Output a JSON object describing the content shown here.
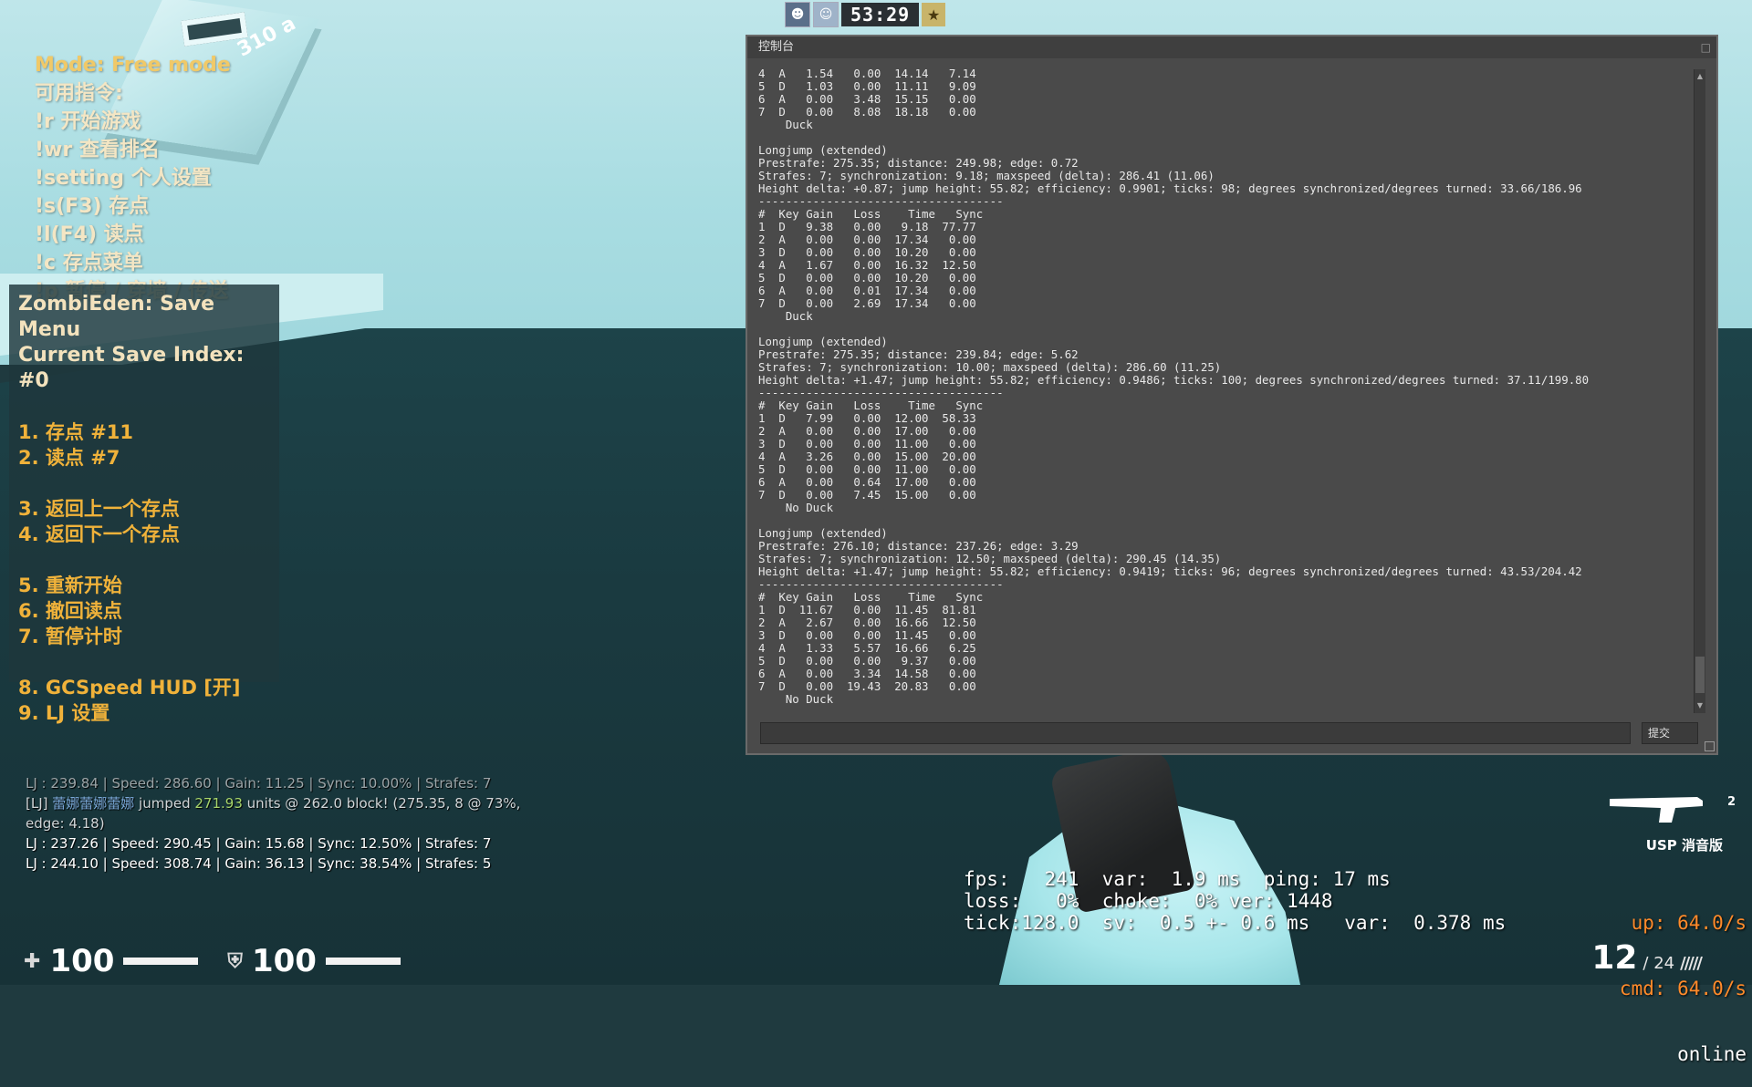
{
  "scoreboard": {
    "timer": "53:29"
  },
  "cube_label": "310 a",
  "free_mode": {
    "mode": "Mode: Free mode",
    "lines": [
      "可用指令:",
      "!r 开始游戏",
      "!wr 查看排名",
      "!setting 个人设置",
      "!s(F3) 存点",
      "!l(F4) 读点",
      "!c 存点菜单",
      "!p 暂停 / 穿墙 / 传送"
    ]
  },
  "save_menu": {
    "title": "ZombiEden: Save Menu",
    "index": "Current Save Index: #0",
    "items": [
      "1. 存点 #11",
      "2. 读点 #7",
      "3. 返回上一个存点",
      "4. 返回下一个存点",
      "5. 重新开始",
      "6. 撤回读点",
      "7. 暂停计时",
      "8. GCSpeed HUD [开]",
      "9. LJ 设置"
    ]
  },
  "chatlog": {
    "line1": "LJ : 239.84 | Speed: 286.60 | Gain: 11.25 | Sync: 10.00% | Strafes: 7",
    "line2_tag": "[LJ] ",
    "line2_name": "蕾娜蕾娜蕾娜",
    "line2_mid": " jumped ",
    "line2_dist": "271.93",
    "line2_rest": " units @ 262.0 block! (275.35, 8 @ 73%,",
    "line3": "edge: 4.18)",
    "line4": "LJ : 237.26 | Speed: 290.45 | Gain: 15.68 | Sync: 12.50% | Strafes: 7",
    "line5": "LJ : 244.10 | Speed: 308.74 | Gain: 36.13 | Sync: 38.54% | Strafes: 5"
  },
  "console": {
    "title": "控制台",
    "submit": "提交",
    "output": "4  A   1.54   0.00  14.14   7.14\n5  D   1.03   0.00  11.11   9.09\n6  A   0.00   3.48  15.15   0.00\n7  D   0.00   8.08  18.18   0.00\n    Duck\n\nLongjump (extended)\nPrestrafe: 275.35; distance: 249.98; edge: 0.72\nStrafes: 7; synchronization: 9.18; maxspeed (delta): 286.41 (11.06)\nHeight delta: +0.87; jump height: 55.82; efficiency: 0.9901; ticks: 98; degrees synchronized/degrees turned: 33.66/186.96\n------------------------------------\n#  Key Gain   Loss    Time   Sync\n1  D   9.38   0.00   9.18  77.77\n2  A   0.00   0.00  17.34   0.00\n3  D   0.00   0.00  10.20   0.00\n4  A   1.67   0.00  16.32  12.50\n5  D   0.00   0.00  10.20   0.00\n6  A   0.00   0.01  17.34   0.00\n7  D   0.00   2.69  17.34   0.00\n    Duck\n\nLongjump (extended)\nPrestrafe: 275.35; distance: 239.84; edge: 5.62\nStrafes: 7; synchronization: 10.00; maxspeed (delta): 286.60 (11.25)\nHeight delta: +1.47; jump height: 55.82; efficiency: 0.9486; ticks: 100; degrees synchronized/degrees turned: 37.11/199.80\n------------------------------------\n#  Key Gain   Loss    Time   Sync\n1  D   7.99   0.00  12.00  58.33\n2  A   0.00   0.00  17.00   0.00\n3  D   0.00   0.00  11.00   0.00\n4  A   3.26   0.00  15.00  20.00\n5  D   0.00   0.00  11.00   0.00\n6  A   0.00   0.64  17.00   0.00\n7  D   0.00   7.45  15.00   0.00\n    No Duck\n\nLongjump (extended)\nPrestrafe: 276.10; distance: 237.26; edge: 3.29\nStrafes: 7; synchronization: 12.50; maxspeed (delta): 290.45 (14.35)\nHeight delta: +1.47; jump height: 55.82; efficiency: 0.9419; ticks: 96; degrees synchronized/degrees turned: 43.53/204.42\n------------------------------------\n#  Key Gain   Loss    Time   Sync\n1  D  11.67   0.00  11.45  81.81\n2  A   2.67   0.00  16.66  12.50\n3  D   0.00   0.00  11.45   0.00\n4  A   1.33   5.57  16.66   6.25\n5  D   0.00   0.00   9.37   0.00\n6  A   0.00   3.34  14.58   0.00\n7  D   0.00  19.43  20.83   0.00\n    No Duck"
  },
  "netgraph": {
    "left": "fps:   241  var:  1.9 ms  ping: 17 ms\nloss:   0%  choke:  0% ver: 1448\ntick:128.0  sv:  0.5 +- 0.6 ms   var:  0.378 ms",
    "up": "up: 64.0/s",
    "cmd": "cmd: 64.0/s",
    "status": "online"
  },
  "hud": {
    "health": "100",
    "armor": "100",
    "ammo_clip": "12",
    "ammo_reserve": "/ 24",
    "clip_marks": "/////",
    "weapon_slot": "2",
    "weapon_name": "USP 消音版"
  },
  "colors": {
    "accent_orange": "#f0b23a",
    "console_bg": "#4a4a4a",
    "net_orange": "#ff8a2a"
  }
}
